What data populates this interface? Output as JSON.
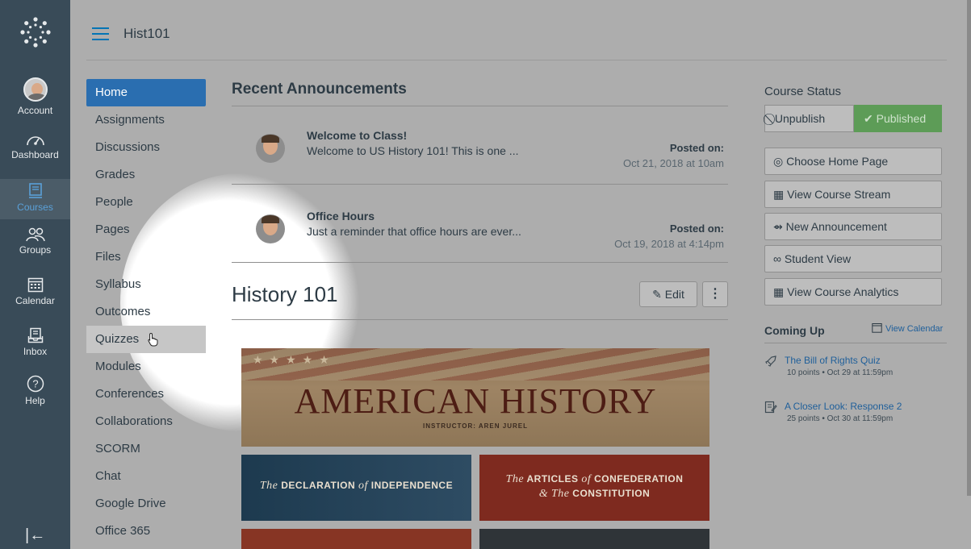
{
  "global_nav": {
    "items": [
      {
        "label": "Account",
        "icon": "avatar"
      },
      {
        "label": "Dashboard",
        "icon": "dashboard-icon"
      },
      {
        "label": "Courses",
        "icon": "courses-icon"
      },
      {
        "label": "Groups",
        "icon": "groups-icon"
      },
      {
        "label": "Calendar",
        "icon": "calendar-icon"
      },
      {
        "label": "Inbox",
        "icon": "inbox-icon"
      },
      {
        "label": "Help",
        "icon": "help-icon"
      }
    ],
    "collapse_glyph": "|←"
  },
  "header": {
    "breadcrumb": "Hist101"
  },
  "course_nav": {
    "items": [
      {
        "label": "Home"
      },
      {
        "label": "Assignments"
      },
      {
        "label": "Discussions"
      },
      {
        "label": "Grades"
      },
      {
        "label": "People"
      },
      {
        "label": "Pages"
      },
      {
        "label": "Files"
      },
      {
        "label": "Syllabus"
      },
      {
        "label": "Outcomes"
      },
      {
        "label": "Quizzes"
      },
      {
        "label": "Modules"
      },
      {
        "label": "Conferences"
      },
      {
        "label": "Collaborations"
      },
      {
        "label": "SCORM"
      },
      {
        "label": "Chat"
      },
      {
        "label": "Google Drive"
      },
      {
        "label": "Office 365"
      }
    ]
  },
  "announcements": {
    "heading": "Recent Announcements",
    "items": [
      {
        "title": "Welcome to Class!",
        "message": "Welcome to US History 101! This is one ...",
        "posted_label": "Posted on:",
        "date": "Oct 21, 2018 at 10am"
      },
      {
        "title": "Office Hours",
        "message": "Just a reminder that office hours are ever...",
        "posted_label": "Posted on:",
        "date": "Oct 19, 2018 at 4:14pm"
      }
    ]
  },
  "course": {
    "title": "History 101",
    "edit_label": "Edit",
    "more_glyph": "⋮"
  },
  "banners": {
    "main_title": "AMERICAN HISTORY",
    "instructor": "INSTRUCTOR: AREN JUREL",
    "declaration_pre": "The",
    "declaration_mid": "DECLARATION",
    "declaration_of": "of",
    "declaration_post": "INDEPENDENCE",
    "articles_pre": "The",
    "articles_mid": "ARTICLES",
    "articles_of": "of",
    "articles_post": "CONFEDERATION",
    "articles_line2_amp": "&",
    "articles_line2_the": "The",
    "articles_line2_post": "CONSTITUTION"
  },
  "sidebar": {
    "status_heading": "Course Status",
    "unpublish_label": "Unpublish",
    "published_label": "Published",
    "buttons": [
      {
        "label": "Choose Home Page"
      },
      {
        "label": "View Course Stream"
      },
      {
        "label": "New Announcement"
      },
      {
        "label": "Student View"
      },
      {
        "label": "View Course Analytics"
      }
    ],
    "coming_up_heading": "Coming Up",
    "view_calendar": "View Calendar",
    "todos": [
      {
        "title": "The Bill of Rights Quiz",
        "sub": "10 points • Oct 29 at 11:59pm"
      },
      {
        "title": "A Closer Look: Response 2",
        "sub": "25 points • Oct 30 at 11:59pm"
      }
    ]
  },
  "colors": {
    "nav_bg": "#394b58",
    "link": "#0374b5",
    "active_course_nav": "#2a6eb0",
    "published": "#5d9c57"
  }
}
